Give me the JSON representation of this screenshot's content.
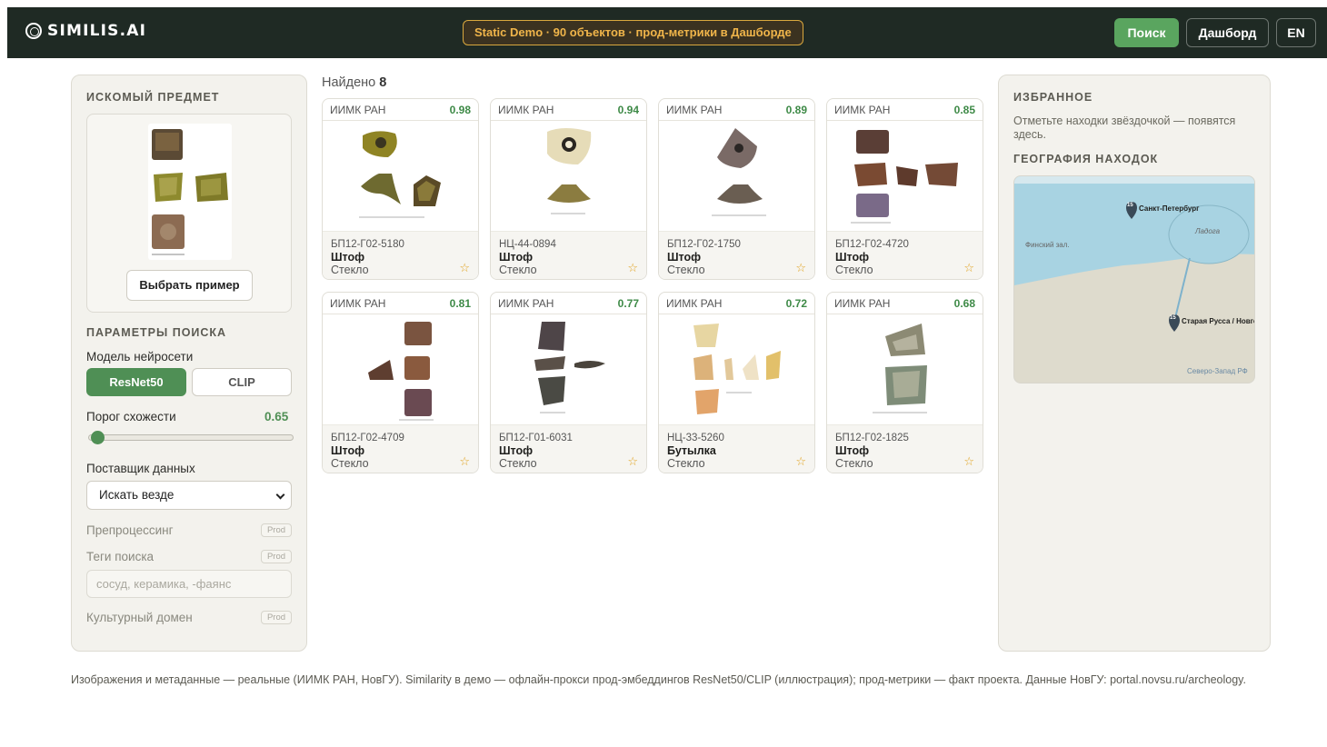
{
  "header": {
    "logo": "SIMILIS.AI",
    "badge": "Static Demo · 90 объектов · прод-метрики в Дашборде",
    "search_btn": "Поиск",
    "dashboard_btn": "Дашборд",
    "lang_btn": "EN"
  },
  "left": {
    "query_title": "ИСКОМЫЙ ПРЕДМЕТ",
    "choose_btn": "Выбрать пример",
    "params_title": "ПАРАМЕТРЫ ПОИСКА",
    "model_label": "Модель нейросети",
    "model_options": [
      "ResNet50",
      "CLIP"
    ],
    "model_selected": "ResNet50",
    "threshold_label": "Порог схожести",
    "threshold_value": "0.65",
    "provider_label": "Поставщик данных",
    "provider_selected": "Искать везде",
    "preprocessing_label": "Препроцессинг",
    "tags_label": "Теги поиска",
    "tags_placeholder": "сосуд, керамика, -фаянс",
    "domain_label": "Культурный домен",
    "prod_tag": "Prod"
  },
  "results": {
    "found_label": "Найдено",
    "found_count": "8",
    "cards": [
      {
        "source": "ИИМК РАН",
        "score": "0.98",
        "code": "БП12-Г02-5180",
        "name": "Штоф",
        "material": "Стекло"
      },
      {
        "source": "ИИМК РАН",
        "score": "0.94",
        "code": "НЦ-44-0894",
        "name": "Штоф",
        "material": "Стекло"
      },
      {
        "source": "ИИМК РАН",
        "score": "0.89",
        "code": "БП12-Г02-1750",
        "name": "Штоф",
        "material": "Стекло"
      },
      {
        "source": "ИИМК РАН",
        "score": "0.85",
        "code": "БП12-Г02-4720",
        "name": "Штоф",
        "material": "Стекло"
      },
      {
        "source": "ИИМК РАН",
        "score": "0.81",
        "code": "БП12-Г02-4709",
        "name": "Штоф",
        "material": "Стекло"
      },
      {
        "source": "ИИМК РАН",
        "score": "0.77",
        "code": "БП12-Г01-6031",
        "name": "Штоф",
        "material": "Стекло"
      },
      {
        "source": "ИИМК РАН",
        "score": "0.72",
        "code": "НЦ-33-5260",
        "name": "Бутылка",
        "material": "Стекло"
      },
      {
        "source": "ИИМК РАН",
        "score": "0.68",
        "code": "БП12-Г02-1825",
        "name": "Штоф",
        "material": "Стекло"
      }
    ]
  },
  "right": {
    "fav_title": "ИЗБРАННОЕ",
    "fav_text": "Отметьте находки звёздочкой — появятся здесь.",
    "geo_title": "ГЕОГРАФИЯ НАХОДОК",
    "map": {
      "sea_label": "Финский зал.",
      "lake_label": "Ладога",
      "city1": "Санкт-Петербург",
      "city1_count": "15",
      "city2": "Старая Русса / Новгород",
      "city2_count": "15",
      "region": "Северо-Запад РФ"
    }
  },
  "footer": "Изображения и метаданные — реальные (ИИМК РАН, НовГУ). Similarity в демо — офлайн-прокси прод-эмбеддингов ResNet50/CLIP (иллюстрация); прод-метрики — факт проекта. Данные НовГУ: portal.novsu.ru/archeology.",
  "colors": {
    "accent": "#4f8f55",
    "header_bg": "#1f2a24",
    "badge": "#f0b54a",
    "star": "#e0a21e"
  }
}
